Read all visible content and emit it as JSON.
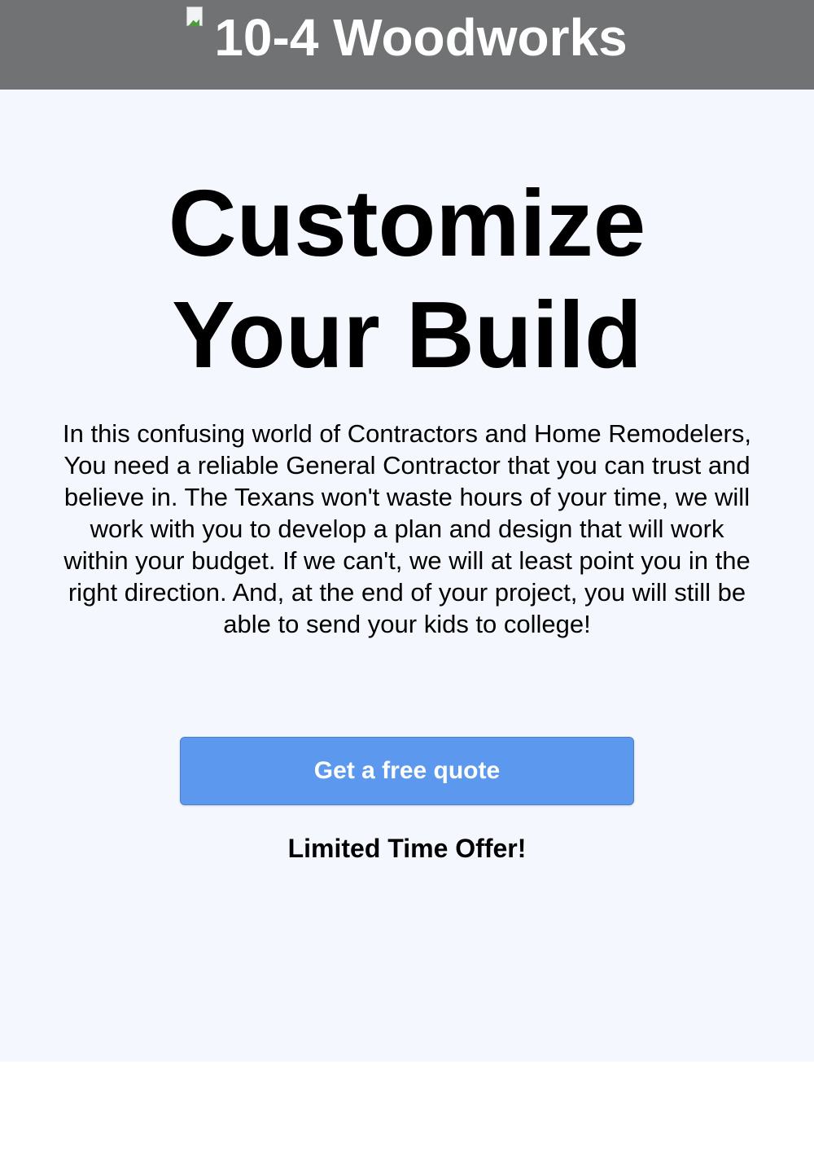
{
  "header": {
    "brand": "10-4 Woodworks",
    "logo_icon": "broken-image-icon",
    "background_color": "#717274"
  },
  "hero": {
    "title_line1": "Customize",
    "title_line2": "Your Build",
    "intro": "In this confusing world of Contractors and Home Remodelers, You need a reliable General Contractor that you can trust and believe in. The Texans won't waste hours of your time, we will work with you to develop a plan and design that will work within your budget. If we can't, we will at least point you in the right direction. And, at the end of your project, you will still be able to send your kids to college!",
    "cta_label": "Get a free quote",
    "offer": "Limited Time Offer!",
    "background_color": "#f4f7fe",
    "cta_color": "#5d98ef"
  }
}
